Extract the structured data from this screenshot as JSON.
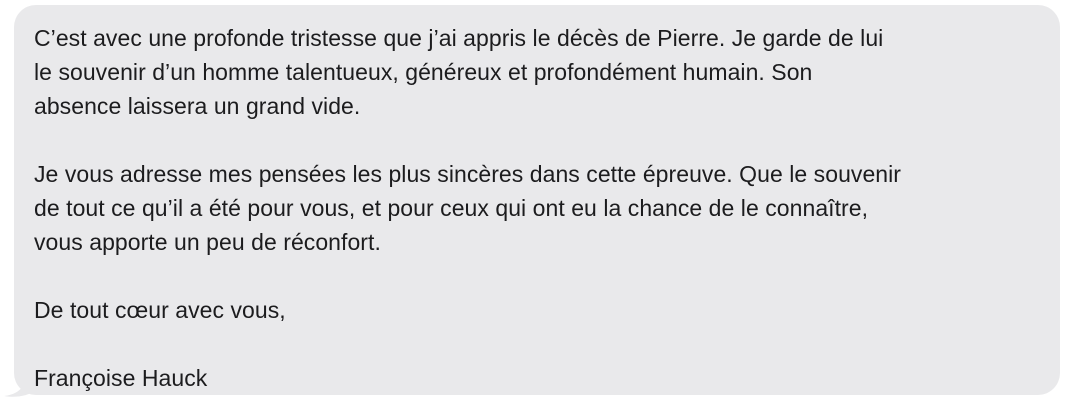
{
  "message": {
    "paragraphs": [
      "C’est avec une profonde tristesse que j’ai appris le décès de Pierre. Je garde de lui\nle souvenir d’un homme talentueux, généreux et profondément humain. Son\nabsence laissera un grand vide.",
      "Je vous adresse mes pensées les plus sincères dans cette épreuve. Que le souvenir\nde tout ce qu’il a été pour vous, et pour ceux qui ont eu la chance de le connaître,\nvous apporte un peu de réconfort.",
      "De tout cœur avec vous,",
      "Françoise Hauck"
    ]
  },
  "colors": {
    "bubble": "#e9e9eb",
    "text": "#1c1c1e"
  }
}
